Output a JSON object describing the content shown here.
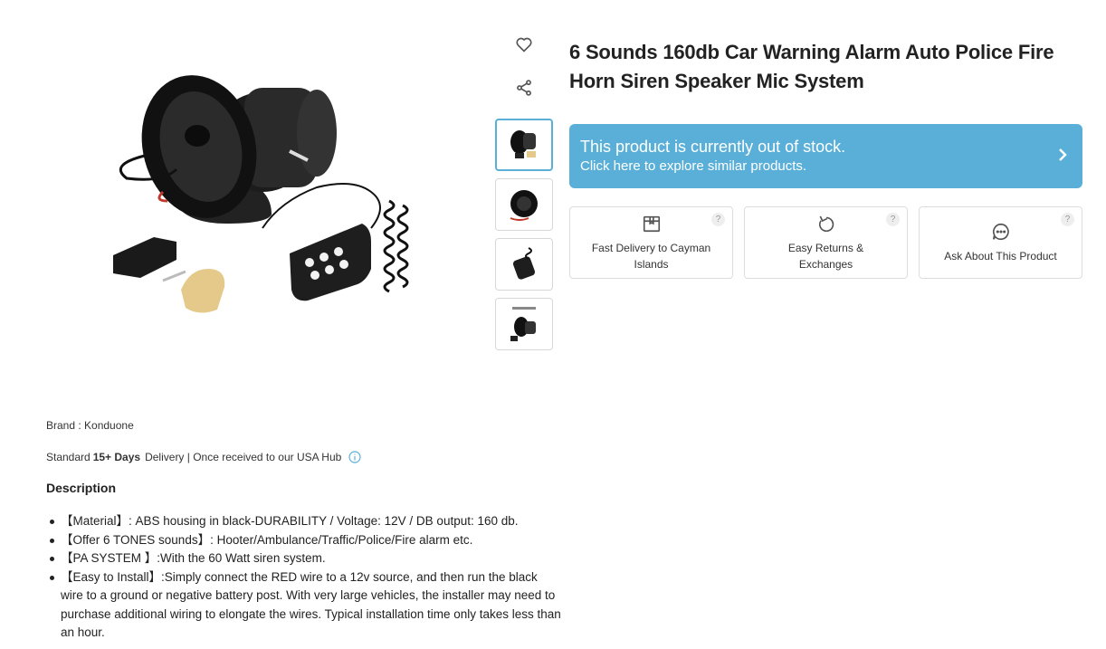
{
  "product": {
    "title": "6 Sounds 160db Car Warning Alarm Auto Police Fire Horn Siren Speaker Mic System",
    "brand_text": "Brand : Konduone"
  },
  "gallery": {
    "main_image_alt": "car siren speaker with microphone",
    "thumbnails": [
      "thumbnail-1",
      "thumbnail-2",
      "thumbnail-3",
      "thumbnail-4"
    ],
    "active_index": 0
  },
  "actions": {
    "like_icon": "heart-icon",
    "share_icon": "share-icon"
  },
  "stock_banner": {
    "line1": "This product is currently out of stock.",
    "line2": "Click here to explore similar products.",
    "color": "#5aafd9"
  },
  "features": [
    {
      "label": "Fast Delivery to Cayman Islands",
      "icon": "box-icon"
    },
    {
      "label": "Easy Returns & Exchanges",
      "icon": "refresh-icon"
    },
    {
      "label": "Ask About This Product",
      "icon": "chat-icon"
    }
  ],
  "delivery": {
    "prefix": "Standard",
    "days": "15+ Days",
    "suffix": "Delivery | Once received to our USA Hub"
  },
  "description": {
    "heading": "Description",
    "items": [
      "【Material】: ABS housing in black-DURABILITY / Voltage: 12V / DB output: 160 db.",
      "【Offer 6 TONES sounds】: Hooter/Ambulance/Traffic/Police/Fire alarm etc.",
      "【PA SYSTEM 】:With the 60 Watt siren system.",
      "【Easy to Install】:Simply connect the RED wire to a 12v source, and then run the black wire to a ground or negative battery post. With very large vehicles, the installer may need to purchase additional wiring to elongate the wires. Typical installation time only takes less than an hour."
    ]
  }
}
